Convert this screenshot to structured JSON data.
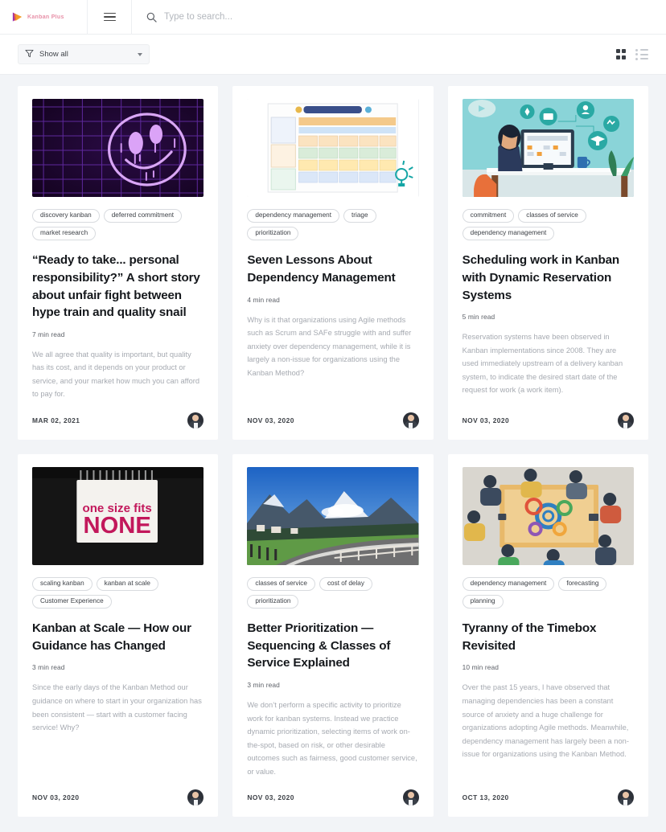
{
  "header": {
    "brand_name": "Kanban Plus",
    "menu_icon": "hamburger-icon",
    "search": {
      "icon": "search-icon",
      "placeholder": "Type to search...",
      "value": ""
    }
  },
  "toolbar": {
    "filter": {
      "icon": "filter-icon",
      "label": "Show all",
      "chevron": "chevron-down-icon"
    },
    "views": {
      "grid_label": "grid-view-icon",
      "list_label": "list-view-icon",
      "active": "grid"
    }
  },
  "cards": [
    {
      "image": "neon-grid-smiley",
      "tags": [
        "discovery kanban",
        "deferred commitment",
        "market research"
      ],
      "title": "“Ready to take... personal responsibility?” A short story about unfair fight between hype train and quality snail",
      "readtime": "7 min read",
      "excerpt": "We all agree that quality is important, but quality has its cost, and it depends on your product or service, and your market how much you can afford to pay for.",
      "date": "MAR 02, 2021",
      "avatar": "author-avatar"
    },
    {
      "image": "dependency-management-board",
      "tags": [
        "dependency management",
        "triage",
        "prioritization"
      ],
      "title": "Seven Lessons About Dependency Management",
      "readtime": "4 min read",
      "excerpt": "Why is it that organizations using Agile methods such as Scrum and SAFe struggle with and suffer anxiety over dependency management, while it is largely a non-issue for organizations using the Kanban Method?",
      "date": "NOV 03, 2020",
      "avatar": "author-avatar"
    },
    {
      "image": "woman-at-desk-elearning",
      "tags": [
        "commitment",
        "classes of service",
        "dependency management"
      ],
      "title": "Scheduling work in Kanban with Dynamic Reservation Systems",
      "readtime": "5 min read",
      "excerpt": "Reservation systems have been observed in Kanban implementations since 2008. They are used immediately upstream of a delivery kanban system, to indicate the desired start date of the request for work (a work item).",
      "date": "NOV 03, 2020",
      "avatar": "author-avatar"
    },
    {
      "image": "one-size-fits-none-label",
      "tags": [
        "scaling kanban",
        "kanban at scale",
        "Customer Experience"
      ],
      "title": "Kanban at Scale — How our Guidance has Changed",
      "readtime": "3 min read",
      "excerpt": "Since the early days of the Kanban Method our guidance on where to start in your organization has been consistent — start with a customer facing service! Why?",
      "date": "NOV 03, 2020",
      "avatar": "author-avatar"
    },
    {
      "image": "mountain-road-landscape",
      "tags": [
        "classes of service",
        "cost of delay",
        "prioritization"
      ],
      "title": "Better Prioritization — Sequencing & Classes of Service Explained",
      "readtime": "3 min read",
      "excerpt": "We don’t perform a specific activity to prioritize work for kanban systems. Instead we practice dynamic prioritization, selecting items of work on-the-spot, based on risk, or other desirable outcomes such as fairness, good customer service, or value.",
      "date": "NOV 03, 2020",
      "avatar": "author-avatar"
    },
    {
      "image": "team-collaboration-overhead",
      "tags": [
        "dependency management",
        "forecasting",
        "planning"
      ],
      "title": "Tyranny of the Timebox Revisited",
      "readtime": "10 min read",
      "excerpt": "Over the past 15 years, I have observed that managing dependencies has been a constant source of anxiety and a huge challenge for organizations adopting Agile methods. Meanwhile, dependency management has largely been a non-issue for organizations using the Kanban Method.",
      "date": "OCT 13, 2020",
      "avatar": "author-avatar"
    }
  ],
  "colors": {
    "page_bg": "#f2f4f7",
    "card_bg": "#ffffff",
    "brand": "#e8527f",
    "title": "#15181c",
    "excerpt": "#a6aab1",
    "tag_border": "#d8dbdf"
  }
}
